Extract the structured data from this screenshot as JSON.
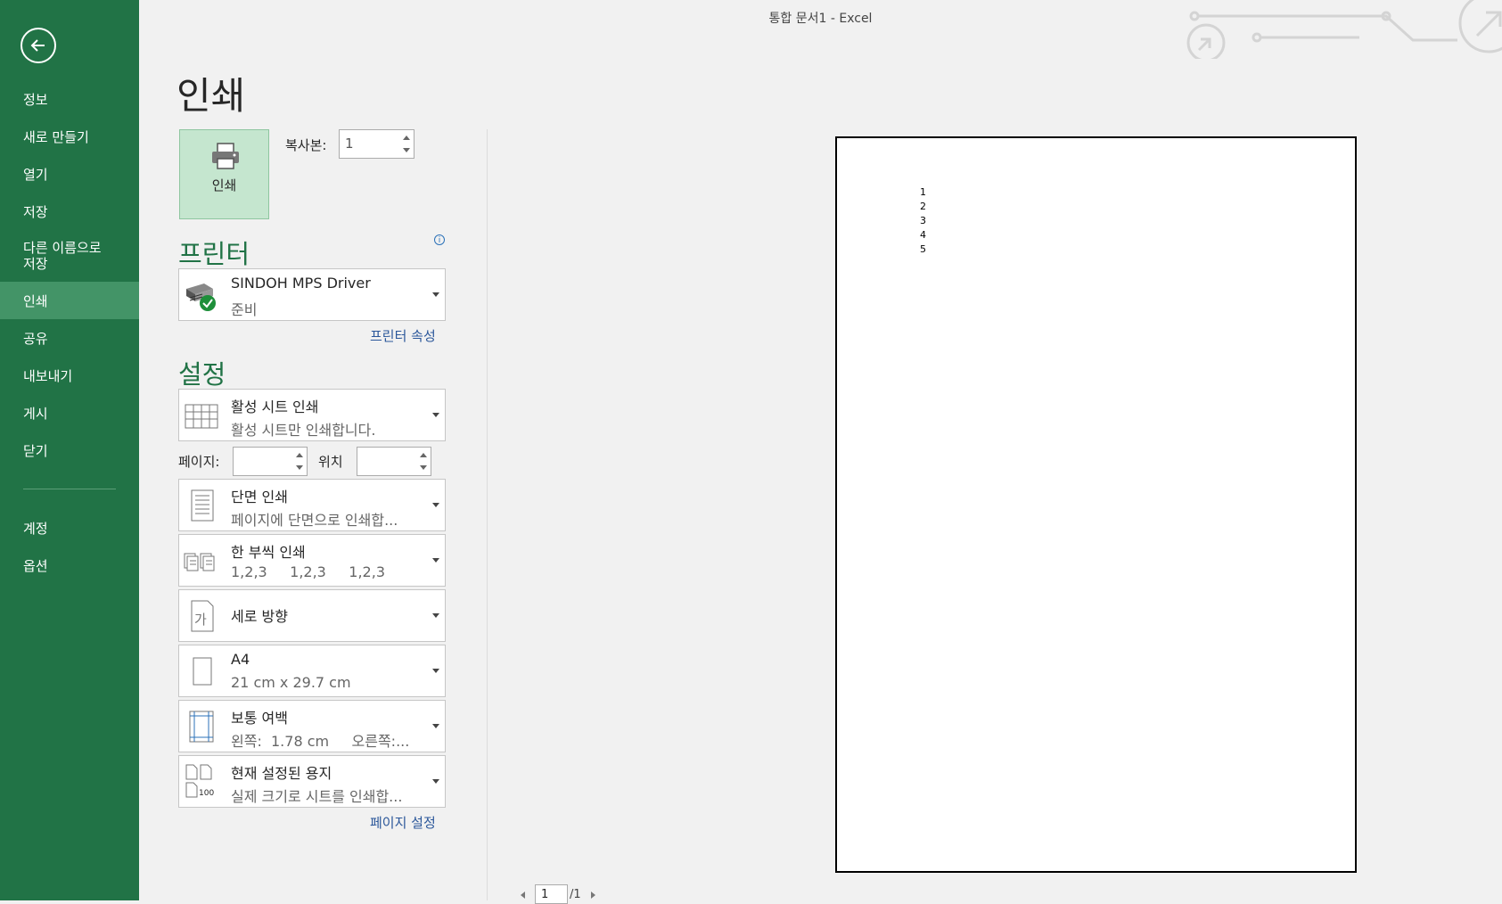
{
  "window": {
    "title": "통합 문서1 - Excel"
  },
  "sidebar": {
    "items": [
      {
        "label": "정보"
      },
      {
        "label": "새로 만들기"
      },
      {
        "label": "열기"
      },
      {
        "label": "저장"
      },
      {
        "label": "다른 이름으로 저장"
      },
      {
        "label": "인쇄"
      },
      {
        "label": "공유"
      },
      {
        "label": "내보내기"
      },
      {
        "label": "게시"
      },
      {
        "label": "닫기"
      },
      {
        "label": "계정"
      },
      {
        "label": "옵션"
      }
    ]
  },
  "print": {
    "title": "인쇄",
    "button_label": "인쇄",
    "copies_label": "복사본:",
    "copies_value": "1"
  },
  "printer": {
    "heading": "프린터",
    "name": "SINDOH MPS Driver",
    "status": "준비",
    "properties_link": "프린터 속성"
  },
  "settings": {
    "heading": "설정",
    "what": {
      "title": "활성 시트 인쇄",
      "desc": "활성 시트만 인쇄합니다."
    },
    "pages_label": "페이지:",
    "pages_value": "",
    "to_label": "위치",
    "to_value": "",
    "sides": {
      "title": "단면 인쇄",
      "desc": "페이지에 단면으로 인쇄합..."
    },
    "collate": {
      "title": "한 부씩 인쇄",
      "desc": "1,2,3     1,2,3     1,2,3"
    },
    "orientation": {
      "title": "세로 방향",
      "icon_text": "가"
    },
    "paper": {
      "title": "A4",
      "desc": "21 cm x 29.7 cm"
    },
    "margins": {
      "title": "보통 여백",
      "desc": "왼쪽:  1.78 cm     오른쪽:..."
    },
    "scaling": {
      "title": "현재 설정된 용지",
      "desc": "실제 크기로 시트를 인쇄합...",
      "icon_text": "100"
    },
    "page_setup_link": "페이지 설정"
  },
  "preview": {
    "cells": [
      "1",
      "2",
      "3",
      "4",
      "5"
    ],
    "current_page": "1",
    "total_pages": "/1"
  }
}
